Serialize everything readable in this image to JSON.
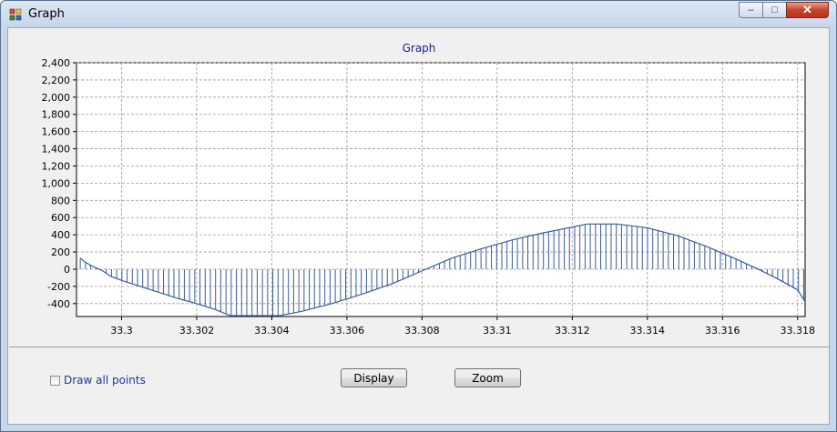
{
  "window": {
    "title": "Graph",
    "controls": {
      "minimize": "–",
      "maximize": "□",
      "close": "✕"
    }
  },
  "options": {
    "draw_all_points_label": "Draw all points",
    "draw_all_points_checked": false
  },
  "buttons": {
    "display_label": "Display",
    "zoom_label": "Zoom"
  },
  "colors": {
    "series": "#3b5a9a",
    "grid": "#9a9a9a",
    "title": "#1a1a8c"
  },
  "chart_data": {
    "type": "line",
    "title": "Graph",
    "xlabel": "",
    "ylabel": "",
    "xlim": [
      33.2988,
      33.3182
    ],
    "ylim": [
      -550,
      2400
    ],
    "yticks": [
      -400,
      -200,
      0,
      200,
      400,
      600,
      800,
      1000,
      1200,
      1400,
      1600,
      1800,
      2000,
      2200,
      2400
    ],
    "ytick_labels": [
      "-400",
      "-200",
      "0",
      "200",
      "400",
      "600",
      "800",
      "1,000",
      "1,200",
      "1,400",
      "1,600",
      "1,800",
      "2,000",
      "2,200",
      "2,400"
    ],
    "xticks": [
      33.3,
      33.302,
      33.304,
      33.306,
      33.308,
      33.31,
      33.312,
      33.314,
      33.316,
      33.318
    ],
    "xtick_labels": [
      "33.3",
      "33.302",
      "33.304",
      "33.306",
      "33.308",
      "33.31",
      "33.312",
      "33.314",
      "33.316",
      "33.318"
    ],
    "grid": true,
    "drop_lines": true,
    "series": [
      {
        "x": [
          33.2989,
          33.299,
          33.2992,
          33.2995,
          33.2997,
          33.3,
          33.3005,
          33.301,
          33.3015,
          33.302,
          33.3025,
          33.3029,
          33.3034,
          33.3042,
          33.3048,
          33.3056,
          33.3064,
          33.3072,
          33.308,
          33.3088,
          33.3096,
          33.3104,
          33.3112,
          33.3124,
          33.3132,
          33.314,
          33.3148,
          33.3156,
          33.3163,
          33.317,
          33.3175,
          33.318,
          33.3182
        ],
        "y": [
          130,
          90,
          40,
          -20,
          -80,
          -130,
          -200,
          -270,
          -340,
          -400,
          -470,
          -540,
          -540,
          -540,
          -490,
          -400,
          -290,
          -170,
          -20,
          130,
          240,
          340,
          420,
          525,
          525,
          480,
          390,
          260,
          130,
          -10,
          -120,
          -240,
          -380
        ]
      }
    ]
  }
}
